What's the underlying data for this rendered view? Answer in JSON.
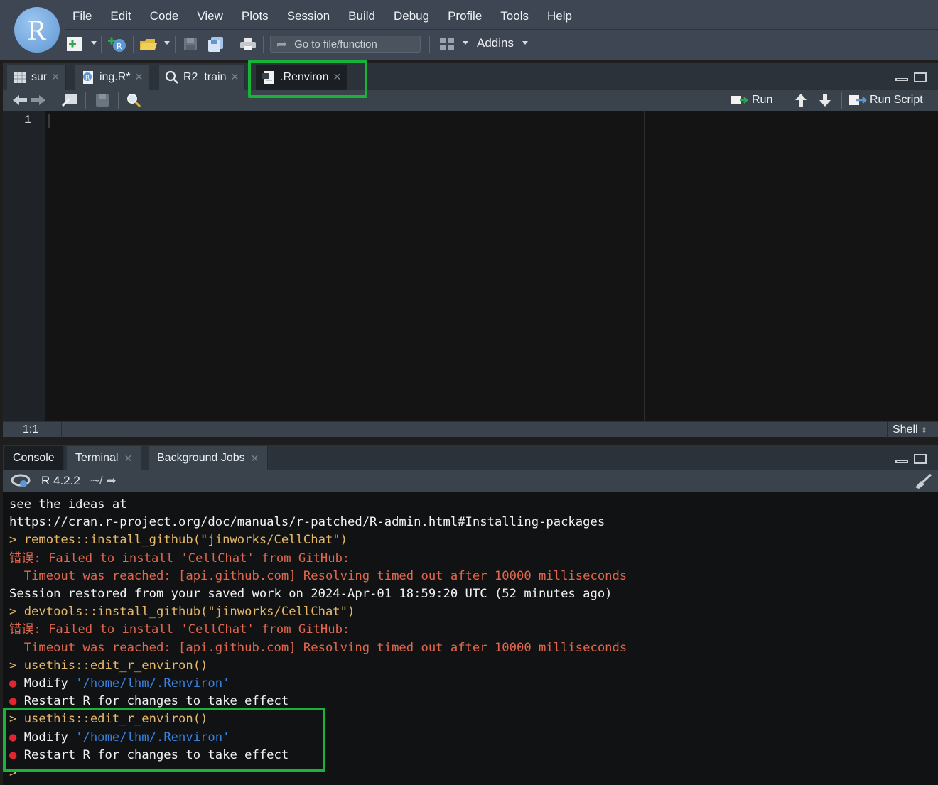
{
  "app": {
    "logo_letter": "R"
  },
  "menu": [
    "File",
    "Edit",
    "Code",
    "View",
    "Plots",
    "Session",
    "Build",
    "Debug",
    "Profile",
    "Tools",
    "Help"
  ],
  "toolbar": {
    "goto_placeholder": "Go to file/function",
    "addins_label": "Addins"
  },
  "editor": {
    "tabs": [
      {
        "label": "sur",
        "icon": "table-icon"
      },
      {
        "label": "ing.R*",
        "icon": "r-script-icon"
      },
      {
        "label": "R2_train",
        "icon": "search-icon"
      },
      {
        "label": ".Renviron",
        "icon": "text-file-icon",
        "active": true
      }
    ],
    "run_label": "Run",
    "run_script_label": "Run Script",
    "line_number": "1",
    "cursor_position": "1:1",
    "file_type": "Shell"
  },
  "console": {
    "tabs": [
      {
        "label": "Console",
        "active": true
      },
      {
        "label": "Terminal"
      },
      {
        "label": "Background Jobs"
      }
    ],
    "r_version": "R 4.2.2",
    "working_dir": "~/",
    "lines": [
      {
        "type": "out",
        "text": "see the ideas at"
      },
      {
        "type": "out",
        "text": "https://cran.r-project.org/doc/manuals/r-patched/R-admin.html#Installing-packages"
      },
      {
        "type": "cmd",
        "text": "> remotes::install_github(\"jinworks/CellChat\")"
      },
      {
        "type": "err",
        "text": "错误: Failed to install 'CellChat' from GitHub:"
      },
      {
        "type": "err",
        "text": "  Timeout was reached: [api.github.com] Resolving timed out after 10000 milliseconds"
      },
      {
        "type": "out",
        "text": "Session restored from your saved work on 2024-Apr-01 18:59:20 UTC (52 minutes ago)"
      },
      {
        "type": "cmd",
        "text": "> devtools::install_github(\"jinworks/CellChat\")"
      },
      {
        "type": "err",
        "text": "错误: Failed to install 'CellChat' from GitHub:"
      },
      {
        "type": "err",
        "text": "  Timeout was reached: [api.github.com] Resolving timed out after 10000 milliseconds"
      },
      {
        "type": "cmd",
        "text": "> usethis::edit_r_environ()"
      },
      {
        "type": "bullet",
        "text": "Modify ",
        "path": "'/home/lhm/.Renviron'"
      },
      {
        "type": "bullet",
        "text": "Restart R for changes to take effect"
      },
      {
        "type": "cmd",
        "text": "> usethis::edit_r_environ()"
      },
      {
        "type": "bullet",
        "text": "Modify ",
        "path": "'/home/lhm/.Renviron'"
      },
      {
        "type": "bullet",
        "text": "Restart R for changes to take effect"
      },
      {
        "type": "cmd",
        "text": ">"
      }
    ]
  },
  "colors": {
    "highlight": "#18b43a",
    "command": "#e6b86a",
    "error": "#e0674e",
    "path": "#3a82e0",
    "bullet": "#e3262e"
  }
}
